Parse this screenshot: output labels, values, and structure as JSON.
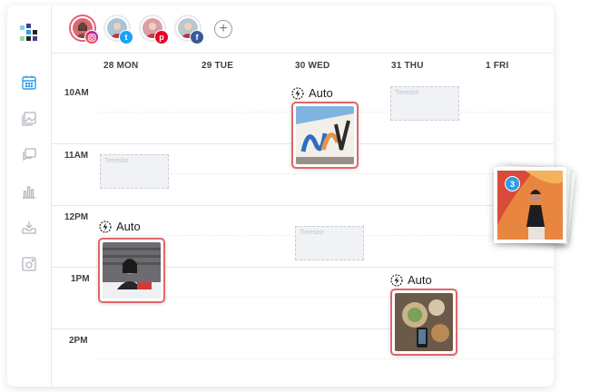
{
  "brand": {
    "logo_icon": "later-logo-icon",
    "colors": {
      "accent": "#2f9de8",
      "selected_border": "#e0666a"
    }
  },
  "sidebar": {
    "items": [
      {
        "id": "calendar",
        "icon": "calendar-icon",
        "active": true
      },
      {
        "id": "media",
        "icon": "image-library-icon",
        "active": false
      },
      {
        "id": "conversations",
        "icon": "chat-icon",
        "active": false
      },
      {
        "id": "analytics",
        "icon": "bar-chart-icon",
        "active": false
      },
      {
        "id": "inbox",
        "icon": "inbox-download-icon",
        "active": false
      },
      {
        "id": "linkinbio",
        "icon": "instagram-frame-icon",
        "active": false
      }
    ]
  },
  "profiles": [
    {
      "network": "instagram",
      "badge_icon": "instagram-icon",
      "badge_color": "#c13584"
    },
    {
      "network": "twitter",
      "badge_icon": "twitter-icon",
      "badge_color": "#1da1f2",
      "badge_glyph": "t"
    },
    {
      "network": "pinterest",
      "badge_icon": "pinterest-icon",
      "badge_color": "#e60023",
      "badge_glyph": "p"
    },
    {
      "network": "facebook",
      "badge_icon": "facebook-icon",
      "badge_color": "#3b5998",
      "badge_glyph": "f"
    }
  ],
  "add_profile": {
    "label": "+"
  },
  "calendar": {
    "days": [
      "28 MON",
      "29 TUE",
      "30 WED",
      "31 THU",
      "1 FRI"
    ],
    "hours": [
      "10AM",
      "11AM",
      "12PM",
      "1PM",
      "2PM"
    ],
    "timeslot_label": "Timeslot",
    "auto_label": "Auto"
  },
  "drag_count": "3"
}
